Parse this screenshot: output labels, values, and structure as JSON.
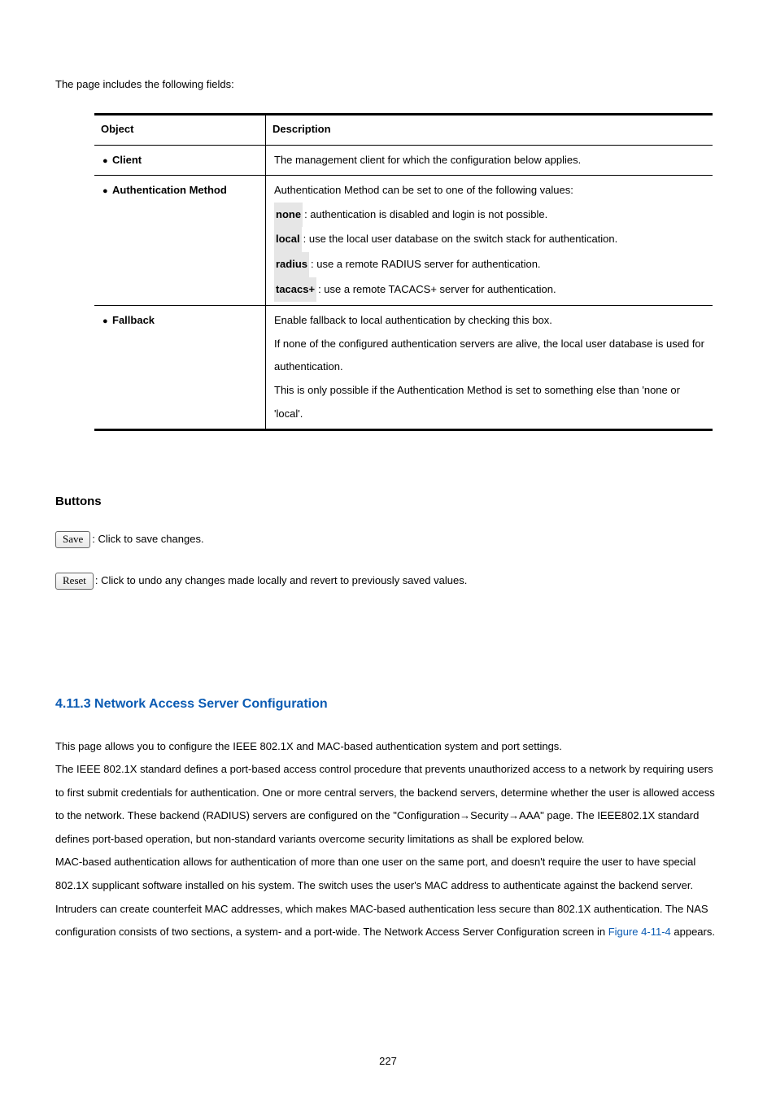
{
  "intro": "The page includes the following fields:",
  "table": {
    "headers": {
      "object": "Object",
      "description": "Description"
    },
    "rows": [
      {
        "label": "Client",
        "lines": [
          {
            "text": "The management client for which the configuration below applies."
          }
        ]
      },
      {
        "label": "Authentication Method",
        "lines": [
          {
            "text": "Authentication Method can be set to one of the following values:"
          },
          {
            "prefix": "none",
            "text": ": authentication is disabled and login is not possible."
          },
          {
            "prefix": "local",
            "text": ": use the local user database on the switch stack for authentication."
          },
          {
            "prefix": "radius",
            "text": ": use a remote RADIUS server for authentication."
          },
          {
            "prefix": "tacacs+",
            "text": ": use a remote TACACS+ server for authentication."
          }
        ]
      },
      {
        "label": "Fallback",
        "lines": [
          {
            "text": "Enable fallback to local authentication by checking this box."
          },
          {
            "text": "If none of the configured authentication servers are alive, the local user database is used for authentication."
          },
          {
            "text": "This is only possible if the Authentication Method is set to something else than 'none or 'local'."
          }
        ]
      }
    ]
  },
  "buttons_heading": "Buttons",
  "save_label": "Save",
  "save_desc": ": Click to save changes.",
  "reset_label": "Reset",
  "reset_desc": ": Click to undo any changes made locally and revert to previously saved values.",
  "section_heading": "4.11.3 Network Access Server Configuration",
  "para1": "This page allows you to configure the IEEE 802.1X and MAC-based authentication system and port settings.",
  "para2": "The IEEE 802.1X standard defines a port-based access control procedure that prevents unauthorized access to a network by requiring users to first submit credentials for authentication. One or more central servers, the backend servers, determine whether the user is allowed access to the network. These backend (RADIUS) servers are configured on the \"Configuration→Security→AAA\" page. The IEEE802.1X standard defines port-based operation, but non-standard variants overcome security limitations as shall be explored below.",
  "para3a": "MAC-based authentication allows for authentication of more than one user on the same port, and doesn't require the user to have special 802.1X supplicant software installed on his system. The switch uses the user's MAC address to authenticate against the backend server. Intruders can create counterfeit MAC addresses, which makes MAC-based authentication less secure than 802.1X authentication. The NAS configuration consists of two sections, a system- and a port-wide. The Network Access Server Configuration screen in ",
  "figure_label": "Figure 4-11-4",
  "para3b": " appears.",
  "page_number": "227"
}
